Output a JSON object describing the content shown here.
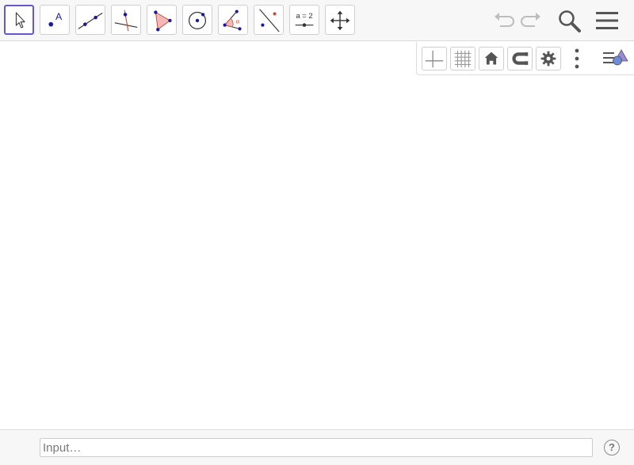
{
  "toolbar": {
    "tools": [
      {
        "id": "move",
        "icon": "cursor-arrow-icon"
      },
      {
        "id": "point",
        "icon": "point-icon",
        "label": "A"
      },
      {
        "id": "line",
        "icon": "line-through-two-points-icon"
      },
      {
        "id": "perpendicular-line",
        "icon": "perpendicular-line-icon"
      },
      {
        "id": "polygon",
        "icon": "polygon-icon"
      },
      {
        "id": "circle",
        "icon": "circle-center-point-icon"
      },
      {
        "id": "angle",
        "icon": "angle-icon",
        "label": "α"
      },
      {
        "id": "reflect",
        "icon": "reflect-about-line-icon"
      },
      {
        "id": "slider",
        "icon": "slider-icon",
        "label": "a = 2"
      },
      {
        "id": "move-graphics",
        "icon": "move-graphics-view-icon"
      }
    ],
    "selected": "move",
    "undo_icon": "undo-icon",
    "redo_icon": "redo-icon",
    "search_icon": "search-icon",
    "menu_icon": "menu-icon"
  },
  "style_bar": {
    "buttons": [
      "axes-icon",
      "grid-icon",
      "home-icon",
      "magnet-icon",
      "gear-icon",
      "more-vertical-icon",
      "style-bar-toggle-icon"
    ]
  },
  "input_bar": {
    "placeholder": "Input…",
    "help_label": "?"
  },
  "colors": {
    "accent": "#6557d2",
    "point": "#1a1a9e",
    "polygon_fill": "#f4b8b8",
    "icon_gray": "#555555"
  }
}
